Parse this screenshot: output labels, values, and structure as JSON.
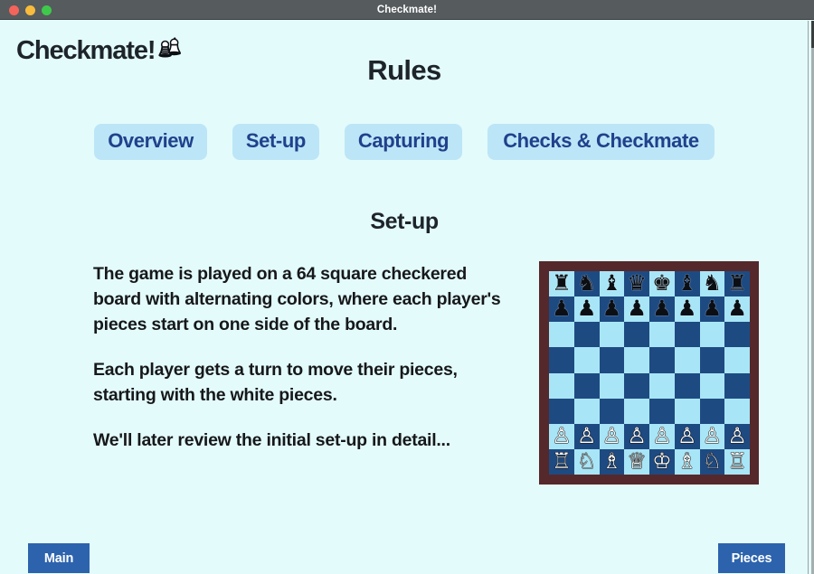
{
  "window": {
    "title": "Checkmate!",
    "controls": [
      {
        "name": "close",
        "color": "#f4645a"
      },
      {
        "name": "minimize",
        "color": "#f8bb3c"
      },
      {
        "name": "maximize",
        "color": "#3fc94b"
      }
    ]
  },
  "header": {
    "brand_text": "Checkmate!",
    "brand_icon": "chess-pieces-icon",
    "page_title": "Rules"
  },
  "tabs": [
    {
      "id": "overview",
      "label": "Overview"
    },
    {
      "id": "set-up",
      "label": "Set-up"
    },
    {
      "id": "capturing",
      "label": "Capturing"
    },
    {
      "id": "checks",
      "label": "Checks & Checkmate"
    }
  ],
  "content": {
    "section_heading": "Set-up",
    "paragraphs": [
      "The game is played on a 64 square checkered board with alternating colors, where each player's pieces start on one side of the board.",
      "Each player gets a turn to move their pieces, starting with the white pieces.",
      "We'll later review the initial set-up in detail..."
    ]
  },
  "chessboard": {
    "caption": "chessboard-starting-position",
    "frame_color": "#55282b",
    "light_square_color": "#a8e6f7",
    "dark_square_color": "#1e4a82",
    "rows": [
      [
        "♜",
        "♞",
        "♝",
        "♛",
        "♚",
        "♝",
        "♞",
        "♜"
      ],
      [
        "♟",
        "♟",
        "♟",
        "♟",
        "♟",
        "♟",
        "♟",
        "♟"
      ],
      [
        "",
        "",
        "",
        "",
        "",
        "",
        "",
        ""
      ],
      [
        "",
        "",
        "",
        "",
        "",
        "",
        "",
        ""
      ],
      [
        "",
        "",
        "",
        "",
        "",
        "",
        "",
        ""
      ],
      [
        "",
        "",
        "",
        "",
        "",
        "",
        "",
        ""
      ],
      [
        "♙",
        "♙",
        "♙",
        "♙",
        "♙",
        "♙",
        "♙",
        "♙"
      ],
      [
        "♖",
        "♘",
        "♗",
        "♕",
        "♔",
        "♗",
        "♘",
        "♖"
      ]
    ]
  },
  "footer": {
    "main_label": "Main",
    "pieces_label": "Pieces"
  },
  "colors": {
    "page_background": "#e4fbfb",
    "tab_background": "#bce6f7",
    "tab_text": "#20418c",
    "button_background": "#2d63ad",
    "heading_text": "#1d242b"
  }
}
